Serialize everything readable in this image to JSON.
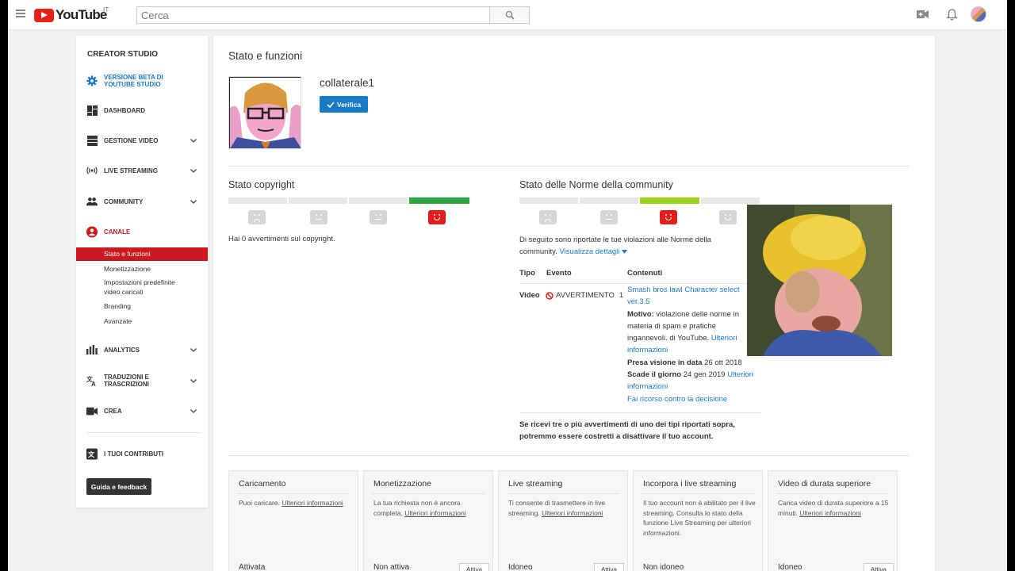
{
  "header": {
    "logo_text": "YouTube",
    "logo_country": "IT",
    "search_placeholder": "Cerca"
  },
  "sidebar": {
    "title": "CREATOR STUDIO",
    "beta_label": "VERSIONE BETA DI YOUTUBE STUDIO",
    "items": [
      {
        "label": "DASHBOARD"
      },
      {
        "label": "GESTIONE VIDEO"
      },
      {
        "label": "LIVE STREAMING"
      },
      {
        "label": "COMMUNITY"
      },
      {
        "label": "CANALE"
      },
      {
        "label": "ANALYTICS"
      },
      {
        "label": "TRADUZIONI E TRASCRIZIONI"
      },
      {
        "label": "CREA"
      },
      {
        "label": "I TUOI CONTRIBUTI"
      }
    ],
    "channel_sub": [
      {
        "label": "Stato e funzioni"
      },
      {
        "label": "Monetizzazione"
      },
      {
        "label": "Impostazioni predefinite video caricati"
      },
      {
        "label": "Branding"
      },
      {
        "label": "Avanzate"
      }
    ],
    "help_button": "Guida e feedback"
  },
  "main": {
    "page_title": "Stato e funzioni",
    "channel_name": "collaterale1",
    "verify_label": "Verifica",
    "copyright": {
      "title": "Stato copyright",
      "strike_level": 0,
      "text": "Hai 0 avvertimenti sul copyright."
    },
    "community": {
      "title": "Stato delle Norme della community",
      "strike_level": 1,
      "intro": "Di seguito sono riportate le tue violazioni alle Norme della community.",
      "details_link": "Visualizza dettagli",
      "table_headers": [
        "Tipo",
        "Evento",
        "Contenuti"
      ],
      "row": {
        "type": "Video",
        "event": "AVVERTIMENTO",
        "count": "1",
        "video_title": "Smash bros lawl Character select ver.3.5",
        "reason_label": "Motivo:",
        "reason_text": "violazione delle norme in materia di spam e pratiche ingannevoli. di YouTube.",
        "more_info": "Ulteriori informazioni",
        "seen_label": "Presa visione in data",
        "seen_date": "26 ott 2018",
        "expires_label": "Scade il giorno",
        "expires_date": "24 gen 2019",
        "more_info2": "Ulteriori informazioni",
        "appeal": "Fai ricorso contro la decisione"
      },
      "warning": "Se ricevi tre o più avvertimenti di uno dei tipi riportati sopra, potremmo essere costretti a disattivare il tuo account."
    },
    "cards": [
      {
        "title": "Caricamento",
        "desc": "Puoi caricare.",
        "link": "Ulteriori informazioni",
        "status": "Attivata",
        "button": ""
      },
      {
        "title": "Monetizzazione",
        "desc": "La tua richiesta non è ancora completa.",
        "link": "Ulteriori informazioni",
        "status": "Non attiva",
        "button": "Attiva"
      },
      {
        "title": "Live streaming",
        "desc": "Ti consente di trasmettere in live streaming.",
        "link": "Ulteriori informazioni",
        "status": "Idoneo",
        "button": "Attiva"
      },
      {
        "title": "Incorpora i live streaming",
        "desc": "Il tuo account non è abilitato per il live streaming. Consulta lo stato della funzione Live Streaming per ulteriori informazioni.",
        "link": "",
        "status": "Non idoneo",
        "button": ""
      },
      {
        "title": "Video di durata superiore",
        "desc": "Carica video di durata superiore a 15 minuti.",
        "link": "Ulteriori informazioni",
        "status": "Idoneo",
        "button": "Attiva"
      }
    ]
  },
  "colors": {
    "brand_red": "#cc181e",
    "link_blue": "#167ac6",
    "strike_green": "#2ba640",
    "strike_lime": "#9bd11a",
    "strike_red": "#e61c1c"
  }
}
